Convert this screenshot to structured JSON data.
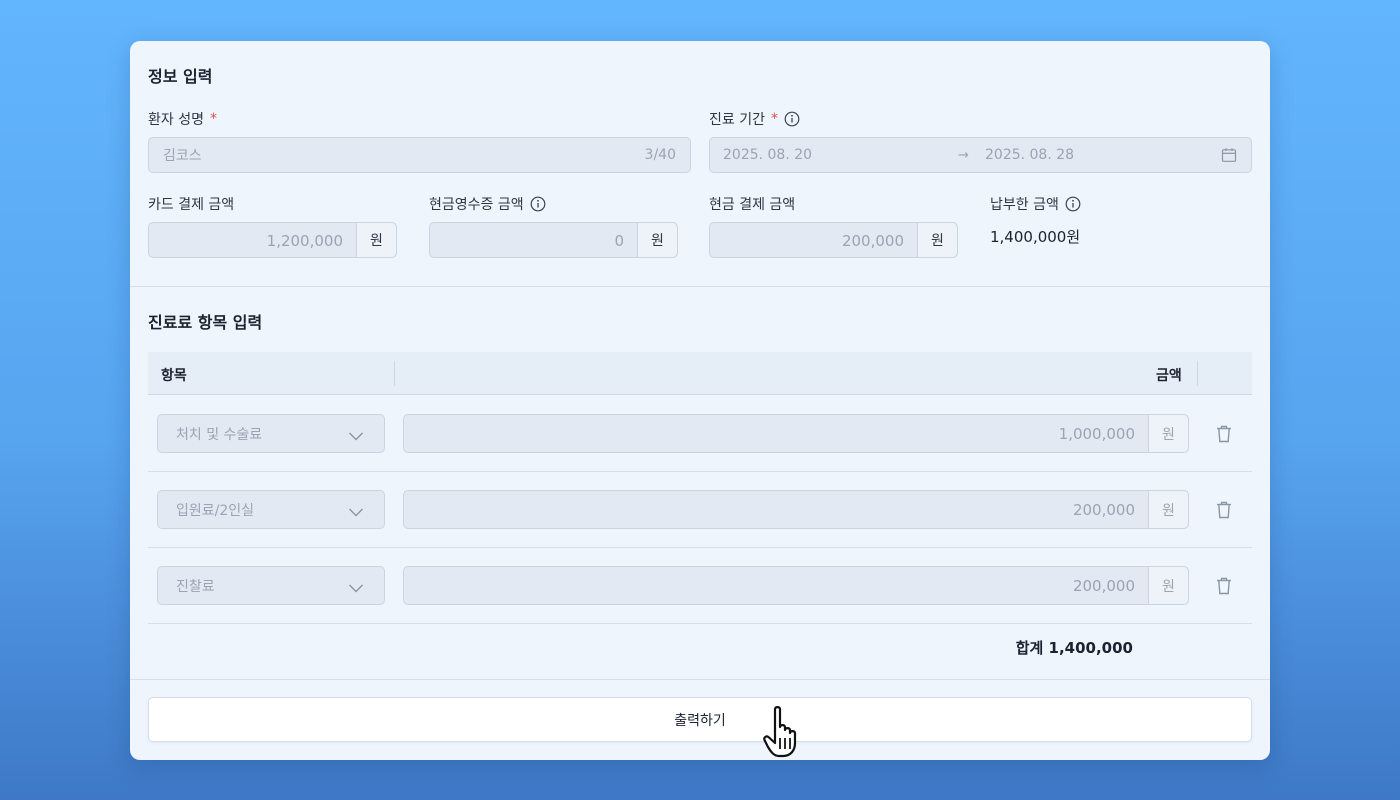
{
  "info_section": {
    "title": "정보 입력",
    "patient_name": {
      "label": "환자 성명",
      "required": "*",
      "value": "김코스",
      "counter": "3/40"
    },
    "period": {
      "label": "진료 기간",
      "required": "*",
      "start": "2025. 08. 20",
      "arrow": "→",
      "end": "2025. 08. 28"
    },
    "card_amount": {
      "label": "카드 결제 금액",
      "value": "1,200,000",
      "unit": "원"
    },
    "cash_receipt_amount": {
      "label": "현금영수증 금액",
      "value": "0",
      "unit": "원"
    },
    "cash_amount": {
      "label": "현금 결제 금액",
      "value": "200,000",
      "unit": "원"
    },
    "paid_amount": {
      "label": "납부한 금액",
      "value": "1,400,000원"
    }
  },
  "fee_section": {
    "title": "진료료 항목 입력",
    "columns": [
      "항목",
      "금액"
    ],
    "rows": [
      {
        "item": "처치 및 수술료",
        "amount": "1,000,000",
        "unit": "원"
      },
      {
        "item": "입원료/2인실",
        "amount": "200,000",
        "unit": "원"
      },
      {
        "item": "진찰료",
        "amount": "200,000",
        "unit": "원"
      }
    ],
    "total": "합계 1,400,000"
  },
  "print_button": "출력하기",
  "icons": {
    "info": "info-icon",
    "calendar": "calendar-icon",
    "chevron": "chevron-down-icon",
    "trash": "trash-icon",
    "cursor": "hand-pointer-icon"
  },
  "colors": {
    "background": "#5fb0fa",
    "card": "#eef5fd",
    "input": "#e2e9f3",
    "required": "#e5484d"
  }
}
